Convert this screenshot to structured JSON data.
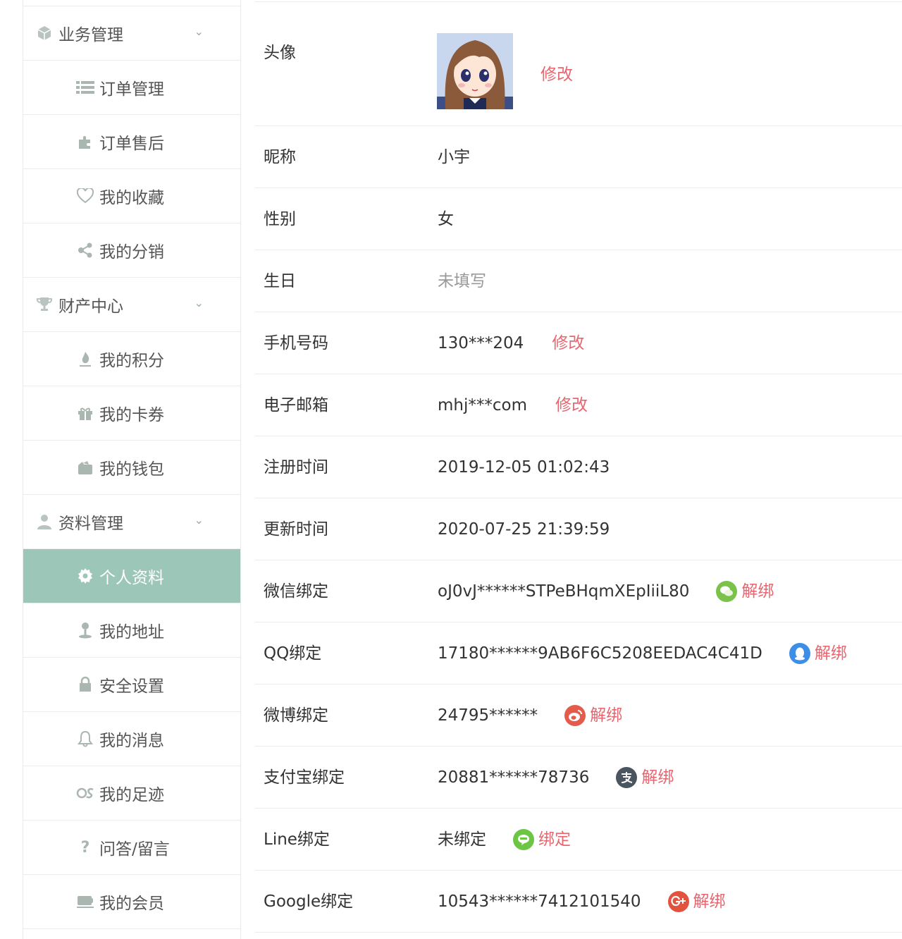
{
  "sidebar": {
    "groups": [
      {
        "label": "业务管理",
        "items": [
          "订单管理",
          "订单售后",
          "我的收藏",
          "我的分销"
        ]
      },
      {
        "label": "财产中心",
        "items": [
          "我的积分",
          "我的卡券",
          "我的钱包"
        ]
      },
      {
        "label": "资料管理",
        "items": [
          "个人资料",
          "我的地址",
          "安全设置",
          "我的消息",
          "我的足迹",
          "问答/留言",
          "我的会员"
        ]
      }
    ]
  },
  "profile": {
    "avatar": {
      "label": "头像",
      "edit": "修改"
    },
    "nickname": {
      "label": "昵称",
      "value": "小宇"
    },
    "gender": {
      "label": "性别",
      "value": "女"
    },
    "birthday": {
      "label": "生日",
      "value": "未填写"
    },
    "phone": {
      "label": "手机号码",
      "value": "130***204",
      "action": "修改"
    },
    "email": {
      "label": "电子邮箱",
      "value": "mhj***com",
      "action": "修改"
    },
    "register_time": {
      "label": "注册时间",
      "value": "2019-12-05 01:02:43"
    },
    "update_time": {
      "label": "更新时间",
      "value": "2020-07-25 21:39:59"
    },
    "wechat": {
      "label": "微信绑定",
      "value": "oJ0vJ******STPeBHqmXEpIiiL80",
      "action": "解绑"
    },
    "qq": {
      "label": "QQ绑定",
      "value": "17180******9AB6F6C5208EEDAC4C41D",
      "action": "解绑"
    },
    "weibo": {
      "label": "微博绑定",
      "value": "24795******",
      "action": "解绑"
    },
    "alipay": {
      "label": "支付宝绑定",
      "value": "20881******78736",
      "action": "解绑"
    },
    "line": {
      "label": "Line绑定",
      "value": "未绑定",
      "action": "绑定"
    },
    "google": {
      "label": "Google绑定",
      "value": "10543******7412101540",
      "action": "解绑"
    }
  },
  "colors": {
    "accent": "#9cc6b7",
    "action": "#e8666f",
    "wechat": "#7bc24a",
    "qq": "#3d8ee6",
    "weibo": "#e45a4b",
    "alipay": "#4a5560",
    "line": "#6cc644",
    "google": "#e2533f"
  }
}
